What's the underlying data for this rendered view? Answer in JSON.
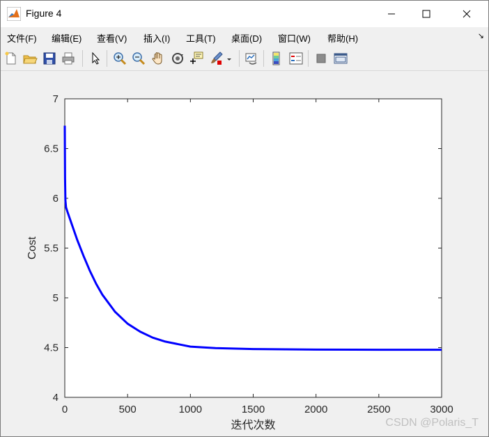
{
  "window": {
    "title": "Figure 4",
    "controls": {
      "minimize": "—",
      "maximize": "☐",
      "close": "✕"
    }
  },
  "menu": {
    "items": [
      "文件(F)",
      "编辑(E)",
      "查看(V)",
      "插入(I)",
      "工具(T)",
      "桌面(D)",
      "窗口(W)",
      "帮助(H)"
    ],
    "overflow_glyph": "↘"
  },
  "toolbar": {
    "icons": [
      "new-figure-icon",
      "open-file-icon",
      "save-icon",
      "print-icon",
      "pointer-icon",
      "zoom-in-icon",
      "zoom-out-icon",
      "pan-hand-icon",
      "rotate-3d-icon",
      "data-cursor-icon",
      "brush-icon",
      "link-plot-icon",
      "colorbar-icon",
      "legend-icon",
      "hide-plot-tools-icon",
      "show-plot-tools-icon"
    ]
  },
  "chart_data": {
    "type": "line",
    "title": "",
    "xlabel": "迭代次数",
    "ylabel": "Cost",
    "xlim": [
      0,
      3000
    ],
    "ylim": [
      4,
      7
    ],
    "xticks": [
      0,
      500,
      1000,
      1500,
      2000,
      2500,
      3000
    ],
    "yticks": [
      4,
      4.5,
      5,
      5.5,
      6,
      6.5,
      7
    ],
    "xtick_labels": [
      "0",
      "500",
      "1000",
      "1500",
      "2000",
      "2500",
      "3000"
    ],
    "ytick_labels": [
      "4",
      "4.5",
      "5",
      "5.5",
      "6",
      "6.5",
      "7"
    ],
    "grid": false,
    "series": [
      {
        "color": "#0000ff",
        "x": [
          0,
          2,
          5,
          10,
          20,
          50,
          100,
          150,
          200,
          250,
          300,
          400,
          500,
          600,
          700,
          800,
          1000,
          1200,
          1500,
          2000,
          2500,
          3000
        ],
        "y": [
          6.73,
          6.2,
          5.98,
          5.91,
          5.87,
          5.76,
          5.58,
          5.42,
          5.27,
          5.14,
          5.03,
          4.86,
          4.74,
          4.66,
          4.6,
          4.56,
          4.51,
          4.495,
          4.485,
          4.48,
          4.478,
          4.478
        ]
      }
    ]
  },
  "watermark": "CSDN @Polaris_T"
}
